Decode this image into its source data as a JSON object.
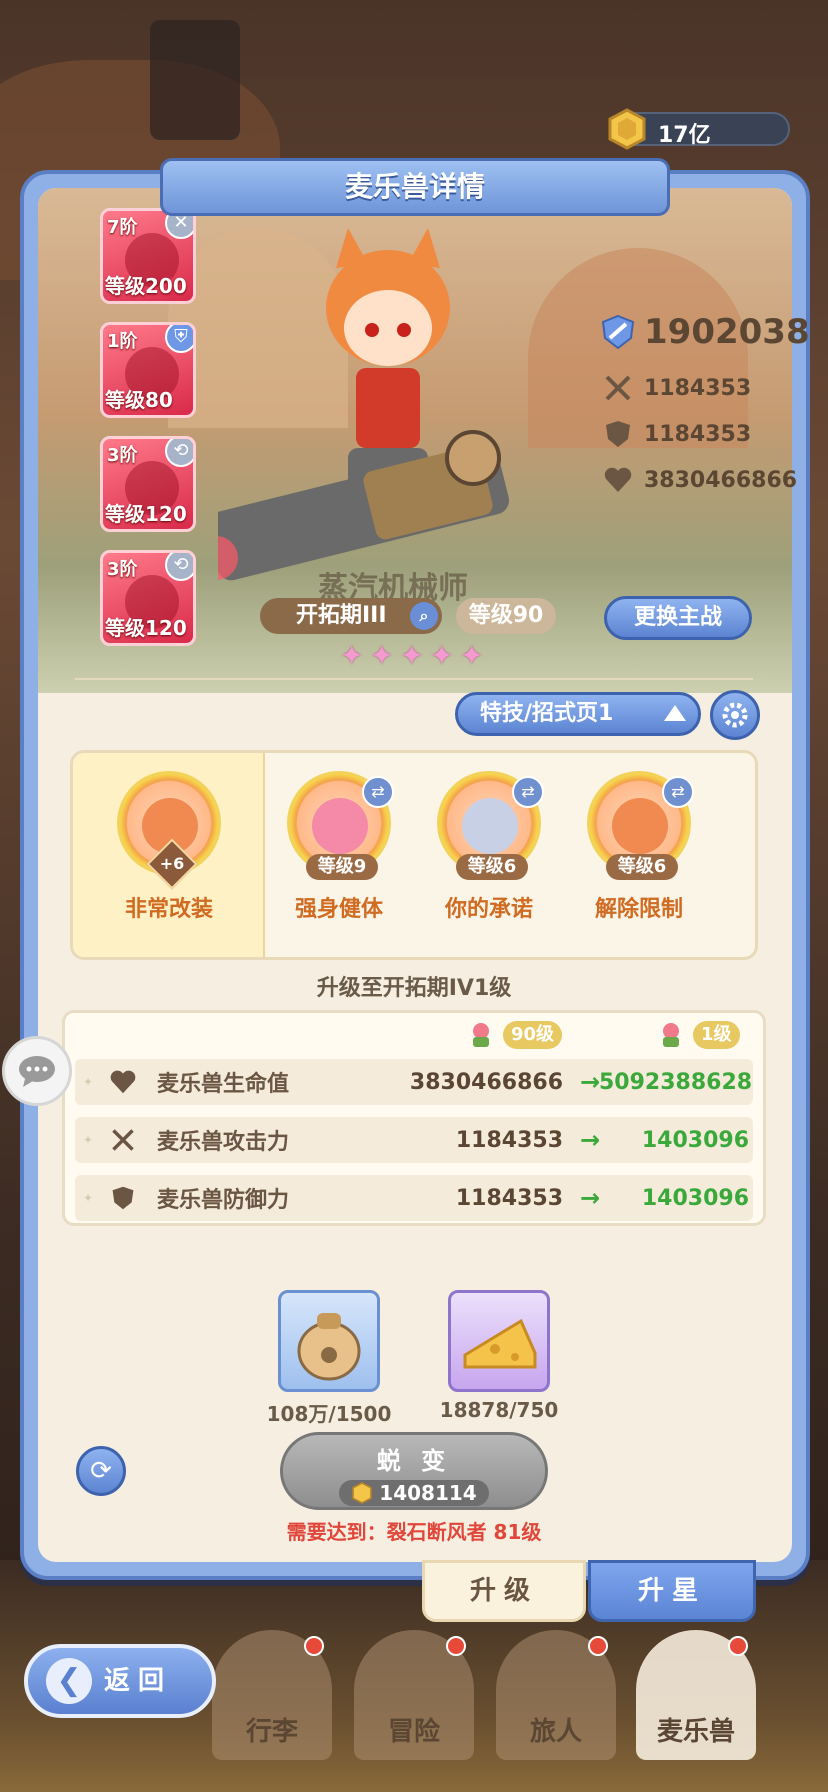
{
  "currency": {
    "icon": "gold-coin-icon",
    "value": "17亿"
  },
  "panel": {
    "title": "麦乐兽详情"
  },
  "hero": {
    "name": "蒸汽机械师",
    "period_label": "开拓期III",
    "level_label": "等级90",
    "stars": 5,
    "change_button": "更换主战"
  },
  "stage_cards": [
    {
      "tier": "7阶",
      "level": "等级200",
      "badge": "✕"
    },
    {
      "tier": "1阶",
      "level": "等级80",
      "badge": "⛨"
    },
    {
      "tier": "3阶",
      "level": "等级120",
      "badge": "⟲"
    },
    {
      "tier": "3阶",
      "level": "等级120",
      "badge": "⟲"
    }
  ],
  "stats": {
    "power": "1902038",
    "attack": "1184353",
    "defense": "1184353",
    "hp": "3830466866"
  },
  "skill_page": {
    "label": "特技/招式页1"
  },
  "skills": [
    {
      "name": "非常改装",
      "badge": "+6"
    },
    {
      "name": "强身健体",
      "level": "等级9"
    },
    {
      "name": "你的承诺",
      "level": "等级6"
    },
    {
      "name": "解除限制",
      "level": "等级6"
    }
  ],
  "upgrade": {
    "title": "升级至开拓期IV1级",
    "from_level": "90级",
    "to_level": "1级",
    "rows": [
      {
        "label": "麦乐兽生命值",
        "icon": "heart-icon",
        "from": "3830466866",
        "to": "5092388628"
      },
      {
        "label": "麦乐兽攻击力",
        "icon": "swords-icon",
        "from": "1184353",
        "to": "1403096"
      },
      {
        "label": "麦乐兽防御力",
        "icon": "shield-icon",
        "from": "1184353",
        "to": "1403096"
      }
    ]
  },
  "materials": [
    {
      "icon": "food-bag-icon",
      "count": "108万/1500"
    },
    {
      "icon": "cheese-icon",
      "count": "18878/750"
    }
  ],
  "evolve": {
    "label": "蜕 变",
    "cost": "1408114"
  },
  "requirement": "需要达到：裂石断风者 81级",
  "tabs": {
    "upgrade": "升级",
    "star": "升星"
  },
  "nav": {
    "back": "返回",
    "items": [
      "行李",
      "冒险",
      "旅人",
      "麦乐兽"
    ]
  },
  "colors": {
    "accent": "#5b84d4",
    "green": "#3aa83a",
    "warning": "#e0473a"
  }
}
